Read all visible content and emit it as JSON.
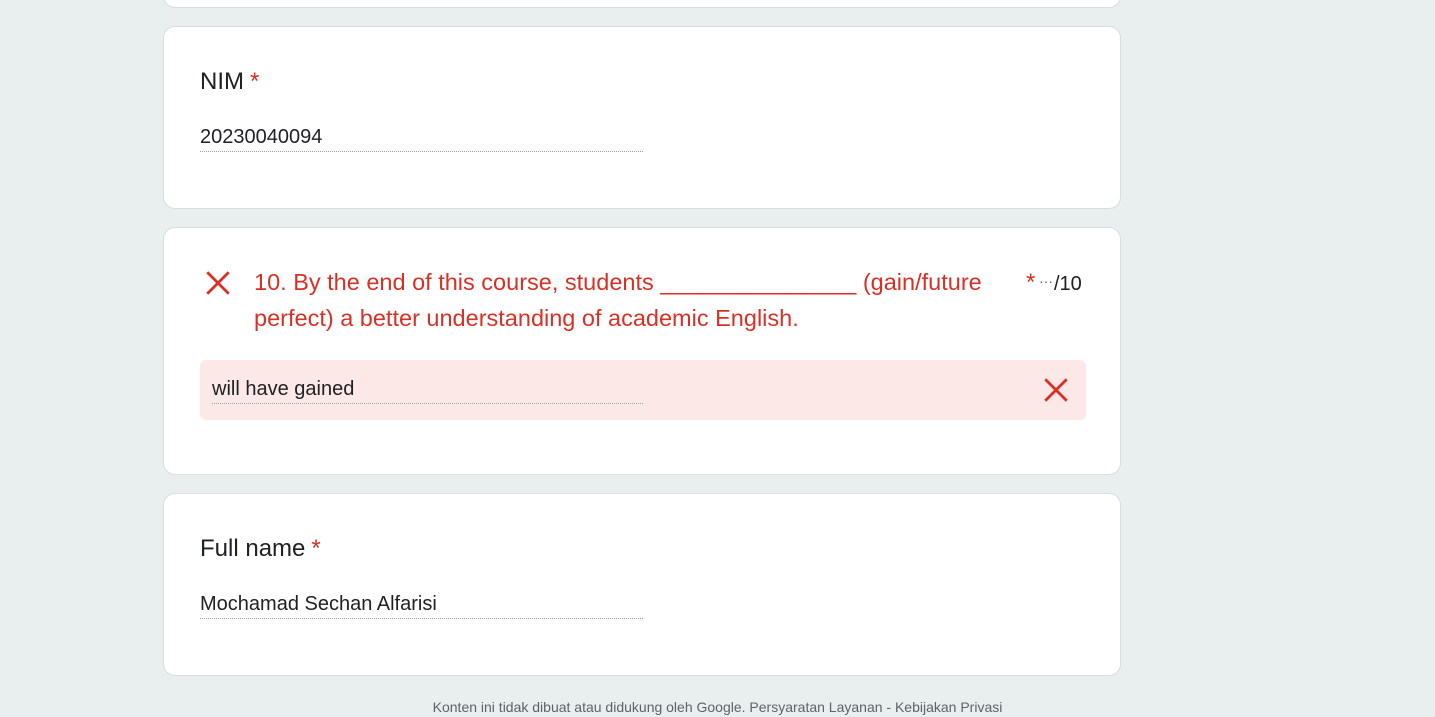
{
  "colors": {
    "background": "#e8efee",
    "card": "#ffffff",
    "error": "#d93025",
    "wrong_answer_bg": "#fce8e6"
  },
  "nim": {
    "label": "NIM",
    "required_mark": "*",
    "value": "20230040094"
  },
  "question10": {
    "status_icon": "close-icon",
    "title": "10. By the end of this course, students _______________ (gain/future perfect) a better understanding of academic English.",
    "required_mark": "*",
    "more": "···",
    "score": "/10",
    "answer": "will have gained",
    "answer_icon": "close-icon"
  },
  "full_name": {
    "label": "Full name",
    "required_mark": "*",
    "value": "Mochamad Sechan Alfarisi"
  },
  "footer": {
    "text": "Konten ini tidak dibuat atau didukung oleh Google. Persyaratan Layanan - Kebijakan Privasi"
  }
}
